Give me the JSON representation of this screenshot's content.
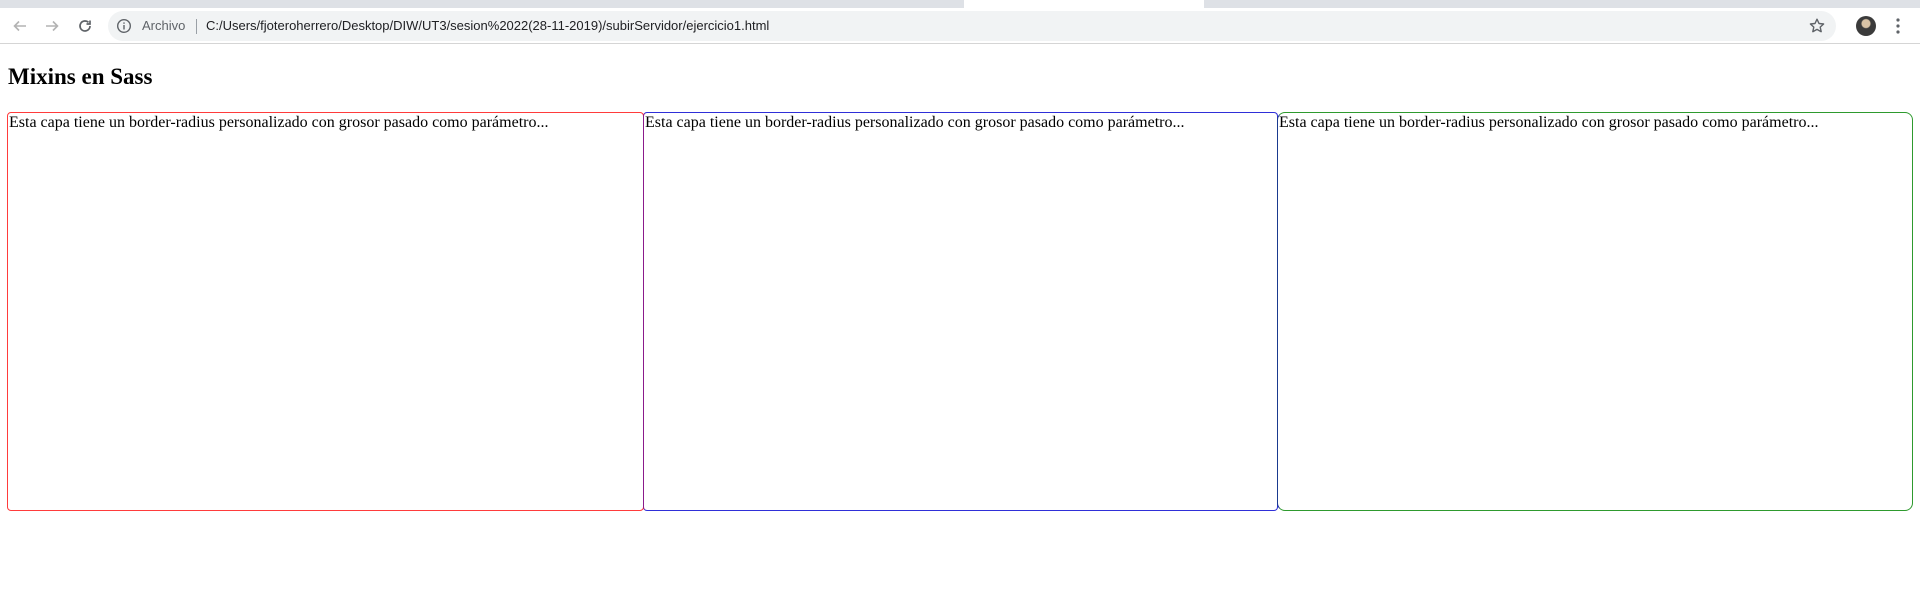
{
  "browser": {
    "scheme_label": "Archivo",
    "url": "C:/Users/fjoteroherrero/Desktop/DIW/UT3/sesion%2022(28-11-2019)/subirServidor/ejercicio1.html",
    "icons": {
      "back": "arrow-left-icon",
      "forward": "arrow-right-icon",
      "reload": "reload-icon",
      "info": "info-icon",
      "bookmark": "star-icon",
      "profile": "avatar",
      "menu": "kebab-menu-icon"
    }
  },
  "page": {
    "title": "Mixins en Sass",
    "capas": [
      {
        "text": "Esta capa tiene un border-radius personalizado con grosor pasado como parámetro...",
        "border_color": "#ff3b3b"
      },
      {
        "text": "Esta capa tiene un border-radius personalizado con grosor pasado como parámetro...",
        "border_color": "#2f2fd8"
      },
      {
        "text": "Esta capa tiene un border-radius personalizado con grosor pasado como parámetro...",
        "border_color": "#2e9a2e"
      }
    ]
  },
  "colors": {
    "chrome_bg": "#dee1e6",
    "omnibox_bg": "#f1f3f4",
    "capa_1_border": "#ff3b3b",
    "capa_2_border_left": "#8b1a8b",
    "capa_2_border": "#2f2fd8",
    "capa_3_border_left": "#1a3a8f",
    "capa_3_border": "#2e9a2e"
  }
}
